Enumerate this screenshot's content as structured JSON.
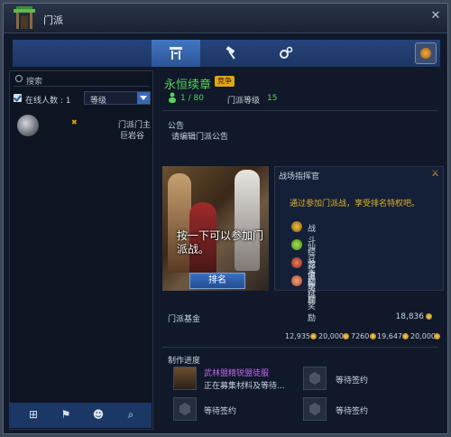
{
  "window": {
    "title": "门派",
    "close_label": "✕"
  },
  "tabs": {
    "items": [
      {
        "icon": "hall-icon",
        "label": "🏯"
      },
      {
        "icon": "hammer-icon",
        "label": "⚒"
      },
      {
        "icon": "gears-icon",
        "label": "⚙"
      }
    ]
  },
  "left": {
    "search_placeholder": "搜索",
    "online_label": "在线人数 : 1",
    "level_select": "等级",
    "member": {
      "role": "门派门主",
      "name": "巨岩谷"
    },
    "bottom_icons": [
      "add-member-icon",
      "manage-icon",
      "members-icon",
      "search-members-icon"
    ]
  },
  "guild": {
    "name": "永恒续章",
    "badge": "竞争",
    "member_count": "1 / 80",
    "level_label": "门派等级",
    "level_value": "15",
    "announcement_title": "公告",
    "announcement_text": "请编辑门派公告",
    "banner_text": "按一下可以参加门派战。",
    "rank_button": "排名",
    "commander_title": "战场指挥官",
    "commander_desc": "通过参加门派战，享受排名特权吧。",
    "perks": [
      {
        "label": "战斗经验值增加",
        "icon": "exp-icon",
        "color": "#e0a020"
      },
      {
        "label": "仙豆奖励",
        "icon": "bean-icon",
        "color": "#7ec83a"
      },
      {
        "label": "龙果奖励",
        "icon": "dragonfruit-icon",
        "color": "#d24a3a"
      },
      {
        "label": "仙桃奖励",
        "icon": "peach-icon",
        "color": "#e07a50"
      }
    ],
    "fund_label": "门派基金",
    "fund_value": "18,836",
    "resources": [
      "12,935",
      "20,000",
      "7260",
      "19,647",
      "20,000"
    ],
    "craft_title": "制作进度",
    "craft_item_name": "武林盟精锐盟徒服",
    "craft_item_status": "正在募集材料及等待...",
    "waiting_label": "等待签约"
  },
  "colors": {
    "accent_green": "#58d25a",
    "accent_gold": "#e0b030",
    "accent_purple": "#c266ee",
    "tab_blue": "#4276c2"
  }
}
